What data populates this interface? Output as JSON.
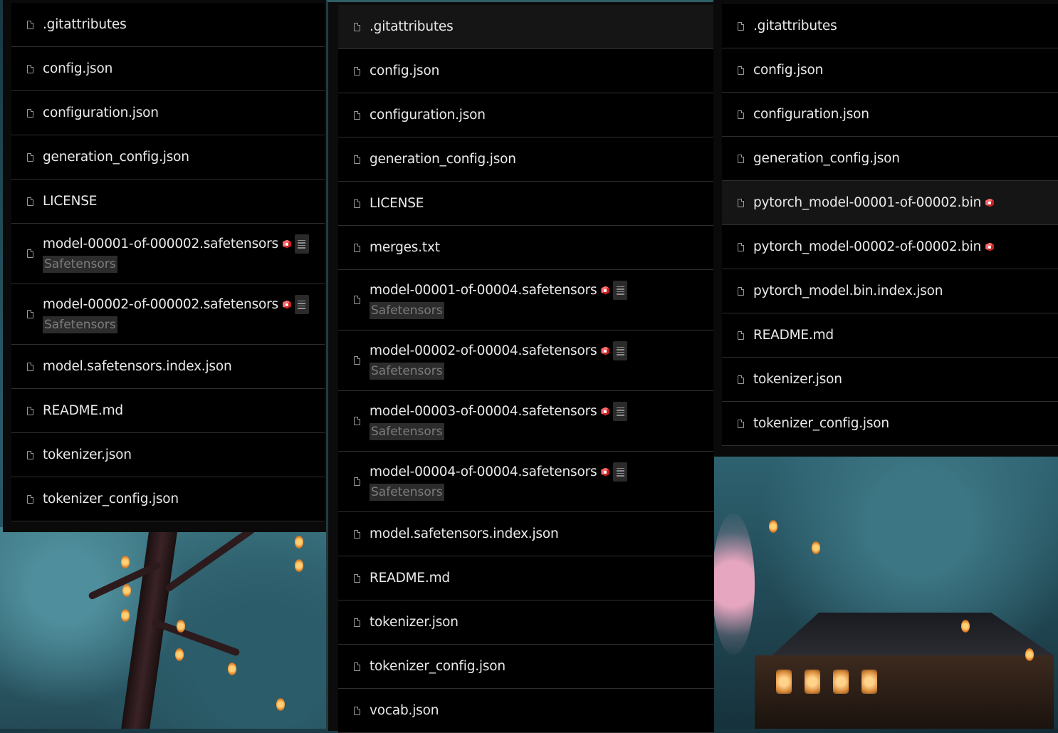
{
  "panels": {
    "left": {
      "files": [
        {
          "name": ".gitattributes"
        },
        {
          "name": "config.json"
        },
        {
          "name": "configuration.json"
        },
        {
          "name": "generation_config.json"
        },
        {
          "name": "LICENSE"
        },
        {
          "name": "model-00001-of-000002.safetensors",
          "lfs": true,
          "tag": "Safetensors"
        },
        {
          "name": "model-00002-of-000002.safetensors",
          "lfs": true,
          "tag": "Safetensors"
        },
        {
          "name": "model.safetensors.index.json"
        },
        {
          "name": "README.md"
        },
        {
          "name": "tokenizer.json"
        },
        {
          "name": "tokenizer_config.json"
        }
      ]
    },
    "middle": {
      "files": [
        {
          "name": ".gitattributes",
          "highlighted": true
        },
        {
          "name": "config.json"
        },
        {
          "name": "configuration.json"
        },
        {
          "name": "generation_config.json"
        },
        {
          "name": "LICENSE"
        },
        {
          "name": "merges.txt"
        },
        {
          "name": "model-00001-of-00004.safetensors",
          "lfs": true,
          "tag": "Safetensors"
        },
        {
          "name": "model-00002-of-00004.safetensors",
          "lfs": true,
          "tag": "Safetensors"
        },
        {
          "name": "model-00003-of-00004.safetensors",
          "lfs": true,
          "tag": "Safetensors"
        },
        {
          "name": "model-00004-of-00004.safetensors",
          "lfs": true,
          "tag": "Safetensors"
        },
        {
          "name": "model.safetensors.index.json"
        },
        {
          "name": "README.md"
        },
        {
          "name": "tokenizer.json"
        },
        {
          "name": "tokenizer_config.json"
        },
        {
          "name": "vocab.json"
        }
      ]
    },
    "right": {
      "files": [
        {
          "name": ".gitattributes"
        },
        {
          "name": "config.json"
        },
        {
          "name": "configuration.json"
        },
        {
          "name": "generation_config.json"
        },
        {
          "name": "pytorch_model-00001-of-00002.bin",
          "lfs": true,
          "highlighted": true
        },
        {
          "name": "pytorch_model-00002-of-00002.bin",
          "lfs": true
        },
        {
          "name": "pytorch_model.bin.index.json"
        },
        {
          "name": "README.md"
        },
        {
          "name": "tokenizer.json"
        },
        {
          "name": "tokenizer_config.json"
        }
      ]
    }
  },
  "icons": {
    "file": "file-icon",
    "lfs": "lfs-storage-icon",
    "viewer": "dataset-viewer-icon"
  },
  "colors": {
    "list_background": "#000000",
    "row_divider": "#2e2e2e",
    "file_name": "#eaeaea",
    "tag_background": "#2c2c2c",
    "tag_text": "#7c7c7c",
    "lfs_icon": "#e03131"
  }
}
